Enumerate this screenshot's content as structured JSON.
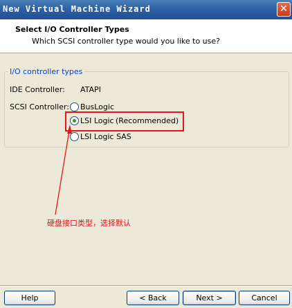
{
  "window": {
    "title": "New Virtual Machine Wizard",
    "close_glyph": "✕"
  },
  "header": {
    "title": "Select I/O Controller Types",
    "subtitle": "Which SCSI controller type would you like to use?"
  },
  "group": {
    "legend": "I/O controller types",
    "ide_label": "IDE Controller:",
    "ide_value": "ATAPI",
    "scsi_label": "SCSI Controller:",
    "options": [
      {
        "label": "BusLogic",
        "selected": false
      },
      {
        "label": "LSI Logic",
        "note": "(Recommended)",
        "selected": true
      },
      {
        "label": "LSI Logic SAS",
        "selected": false
      }
    ]
  },
  "annotation": {
    "text": "硬盘接口类型，选择默认",
    "color": "#E0161B"
  },
  "footer": {
    "help": "Help",
    "back": "< Back",
    "next": "Next >",
    "cancel": "Cancel"
  }
}
